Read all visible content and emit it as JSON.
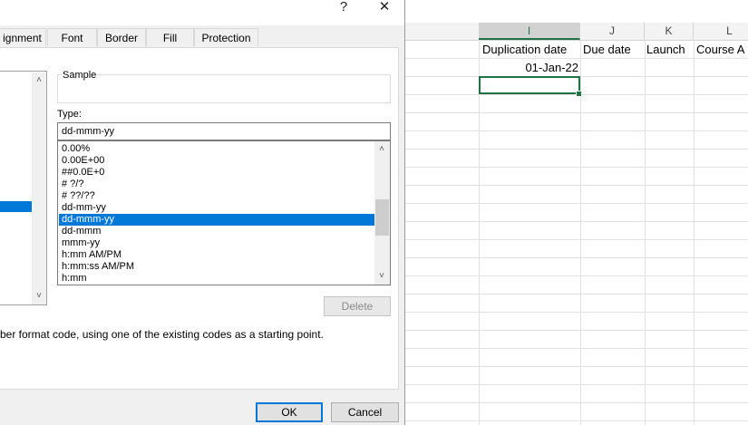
{
  "titlebar": {
    "help_label": "?",
    "close_label": "✕"
  },
  "tabs": [
    {
      "label": "ignment"
    },
    {
      "label": "Font"
    },
    {
      "label": "Border"
    },
    {
      "label": "Fill"
    },
    {
      "label": "Protection"
    }
  ],
  "sample": {
    "label": "Sample",
    "value": ""
  },
  "type": {
    "label": "Type:",
    "value": "dd-mmm-yy"
  },
  "format_list": {
    "items": [
      "0.00%",
      "0.00E+00",
      "##0.0E+0",
      "# ?/?",
      "# ??/??",
      "dd-mm-yy",
      "dd-mmm-yy",
      "dd-mmm",
      "mmm-yy",
      "h:mm AM/PM",
      "h:mm:ss AM/PM",
      "h:mm"
    ],
    "selected": "dd-mmm-yy"
  },
  "delete_label": "Delete",
  "hint_text": "ber format code, using one of the existing codes as a starting point.",
  "ok_label": "OK",
  "cancel_label": "Cancel",
  "sheet": {
    "columns": [
      "I",
      "J",
      "K",
      "L"
    ],
    "selected_column": "I",
    "cells": {
      "i1": "Duplication date",
      "j1": "Due date",
      "k1": "Launch",
      "l1": "Course A",
      "i2": "01-Jan-22"
    }
  },
  "colors": {
    "accent": "#0078d7",
    "excel_green": "#217346"
  }
}
